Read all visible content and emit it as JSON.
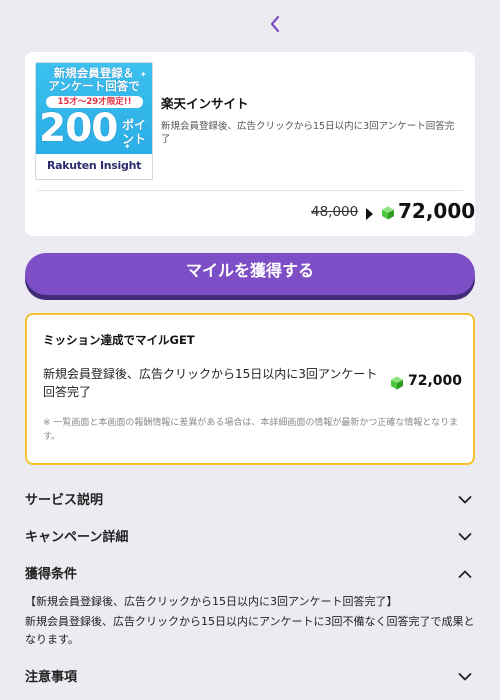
{
  "nav": {
    "back_icon": "chevron-left-icon"
  },
  "offer": {
    "banner": {
      "line1": "新規会員登録＆",
      "line2": "アンケート回答で",
      "age": "15才〜29才限定!!",
      "number": "200",
      "unit": "ポイント",
      "logo": "Rakuten Insight"
    },
    "title": "楽天インサイト",
    "description": "新規会員登録後、広告クリックから15日以内に3回アンケート回答完了",
    "old_price": "48,000",
    "new_price": "72,000",
    "mile_icon": "green-gem-icon"
  },
  "cta_label": "マイルを獲得する",
  "mission": {
    "title": "ミッション達成でマイルGET",
    "description": "新規会員登録後、広告クリックから15日以内に3回アンケート回答完了",
    "reward": "72,000",
    "note": "※ 一覧画面と本画面の報酬情報に差異がある場合は、本詳細画面の情報が最新かつ正確な情報となります。"
  },
  "sections": {
    "service": "サービス説明",
    "campaign": "キャンペーン詳細",
    "conditions": "獲得条件",
    "notes": "注意事項"
  },
  "conditions": {
    "heading": "【新規会員登録後、広告クリックから15日以内に3回アンケート回答完了】",
    "body": "新規会員登録後、広告クリックから15日以内にアンケートに3回不備なく回答完了で成果となります。"
  },
  "colors": {
    "accent": "#7e4ec7",
    "cta_shadow": "#3f2b77",
    "mission_border": "#f5c32a",
    "gem": "#4bc83c",
    "background": "#ecebf1"
  }
}
